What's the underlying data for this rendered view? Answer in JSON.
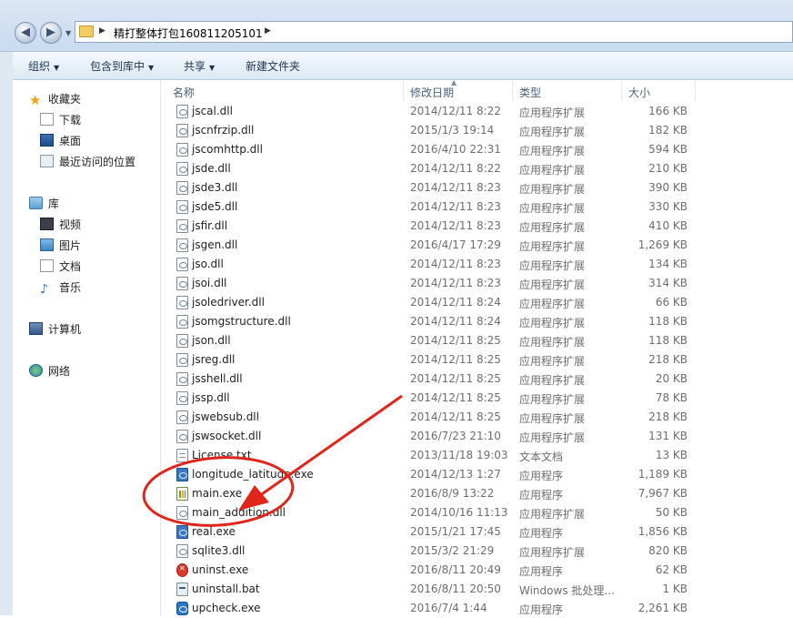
{
  "address": {
    "path": "精打整体打包160811205101"
  },
  "toolbar": {
    "organize": "组织",
    "include": "包含到库中",
    "share": "共享",
    "new_folder": "新建文件夹"
  },
  "nav": {
    "favorites": "收藏夹",
    "downloads": "下载",
    "desktop": "桌面",
    "recent": "最近访问的位置",
    "libraries": "库",
    "videos": "视频",
    "pictures": "图片",
    "documents": "文档",
    "music": "音乐",
    "computer": "计算机",
    "network": "网络"
  },
  "columns": {
    "name": "名称",
    "date": "修改日期",
    "type": "类型",
    "size": "大小"
  },
  "files": [
    {
      "name": "jscal.dll",
      "date": "2014/12/11 8:22",
      "type": "应用程序扩展",
      "size": "166 KB",
      "icon": "dll"
    },
    {
      "name": "jscnfrzip.dll",
      "date": "2015/1/3 19:14",
      "type": "应用程序扩展",
      "size": "182 KB",
      "icon": "dll"
    },
    {
      "name": "jscomhttp.dll",
      "date": "2016/4/10 22:31",
      "type": "应用程序扩展",
      "size": "594 KB",
      "icon": "dll"
    },
    {
      "name": "jsde.dll",
      "date": "2014/12/11 8:22",
      "type": "应用程序扩展",
      "size": "210 KB",
      "icon": "dll"
    },
    {
      "name": "jsde3.dll",
      "date": "2014/12/11 8:23",
      "type": "应用程序扩展",
      "size": "390 KB",
      "icon": "dll"
    },
    {
      "name": "jsde5.dll",
      "date": "2014/12/11 8:23",
      "type": "应用程序扩展",
      "size": "330 KB",
      "icon": "dll"
    },
    {
      "name": "jsfir.dll",
      "date": "2014/12/11 8:23",
      "type": "应用程序扩展",
      "size": "410 KB",
      "icon": "dll"
    },
    {
      "name": "jsgen.dll",
      "date": "2016/4/17 17:29",
      "type": "应用程序扩展",
      "size": "1,269 KB",
      "icon": "dll"
    },
    {
      "name": "jso.dll",
      "date": "2014/12/11 8:23",
      "type": "应用程序扩展",
      "size": "134 KB",
      "icon": "dll"
    },
    {
      "name": "jsoi.dll",
      "date": "2014/12/11 8:23",
      "type": "应用程序扩展",
      "size": "314 KB",
      "icon": "dll"
    },
    {
      "name": "jsoledriver.dll",
      "date": "2014/12/11 8:24",
      "type": "应用程序扩展",
      "size": "66 KB",
      "icon": "dll"
    },
    {
      "name": "jsomgstructure.dll",
      "date": "2014/12/11 8:24",
      "type": "应用程序扩展",
      "size": "118 KB",
      "icon": "dll"
    },
    {
      "name": "json.dll",
      "date": "2014/12/11 8:25",
      "type": "应用程序扩展",
      "size": "118 KB",
      "icon": "dll"
    },
    {
      "name": "jsreg.dll",
      "date": "2014/12/11 8:25",
      "type": "应用程序扩展",
      "size": "218 KB",
      "icon": "dll"
    },
    {
      "name": "jsshell.dll",
      "date": "2014/12/11 8:25",
      "type": "应用程序扩展",
      "size": "20 KB",
      "icon": "dll"
    },
    {
      "name": "jssp.dll",
      "date": "2014/12/11 8:25",
      "type": "应用程序扩展",
      "size": "78 KB",
      "icon": "dll"
    },
    {
      "name": "jswebsub.dll",
      "date": "2014/12/11 8:25",
      "type": "应用程序扩展",
      "size": "218 KB",
      "icon": "dll"
    },
    {
      "name": "jswsocket.dll",
      "date": "2016/7/23 21:10",
      "type": "应用程序扩展",
      "size": "131 KB",
      "icon": "dll"
    },
    {
      "name": "License.txt",
      "date": "2013/11/18 19:03",
      "type": "文本文档",
      "size": "13 KB",
      "icon": "txt"
    },
    {
      "name": "longitude_latitude.exe",
      "date": "2014/12/13 1:27",
      "type": "应用程序",
      "size": "1,189 KB",
      "icon": "exe"
    },
    {
      "name": "main.exe",
      "date": "2016/8/9 13:22",
      "type": "应用程序",
      "size": "7,967 KB",
      "icon": "chart"
    },
    {
      "name": "main_addition.dll",
      "date": "2014/10/16 11:13",
      "type": "应用程序扩展",
      "size": "50 KB",
      "icon": "dll"
    },
    {
      "name": "real.exe",
      "date": "2015/1/21 17:45",
      "type": "应用程序",
      "size": "1,856 KB",
      "icon": "exe"
    },
    {
      "name": "sqlite3.dll",
      "date": "2015/3/2 21:29",
      "type": "应用程序扩展",
      "size": "820 KB",
      "icon": "dll"
    },
    {
      "name": "uninst.exe",
      "date": "2016/8/11 20:49",
      "type": "应用程序",
      "size": "62 KB",
      "icon": "err"
    },
    {
      "name": "uninstall.bat",
      "date": "2016/8/11 20:50",
      "type": "Windows 批处理...",
      "size": "1 KB",
      "icon": "bat"
    },
    {
      "name": "upcheck.exe",
      "date": "2016/7/4 1:44",
      "type": "应用程序",
      "size": "2,261 KB",
      "icon": "upd"
    }
  ],
  "colors": {
    "annotation": "#e0251b",
    "toolbar_bg": "#dde8f4"
  }
}
